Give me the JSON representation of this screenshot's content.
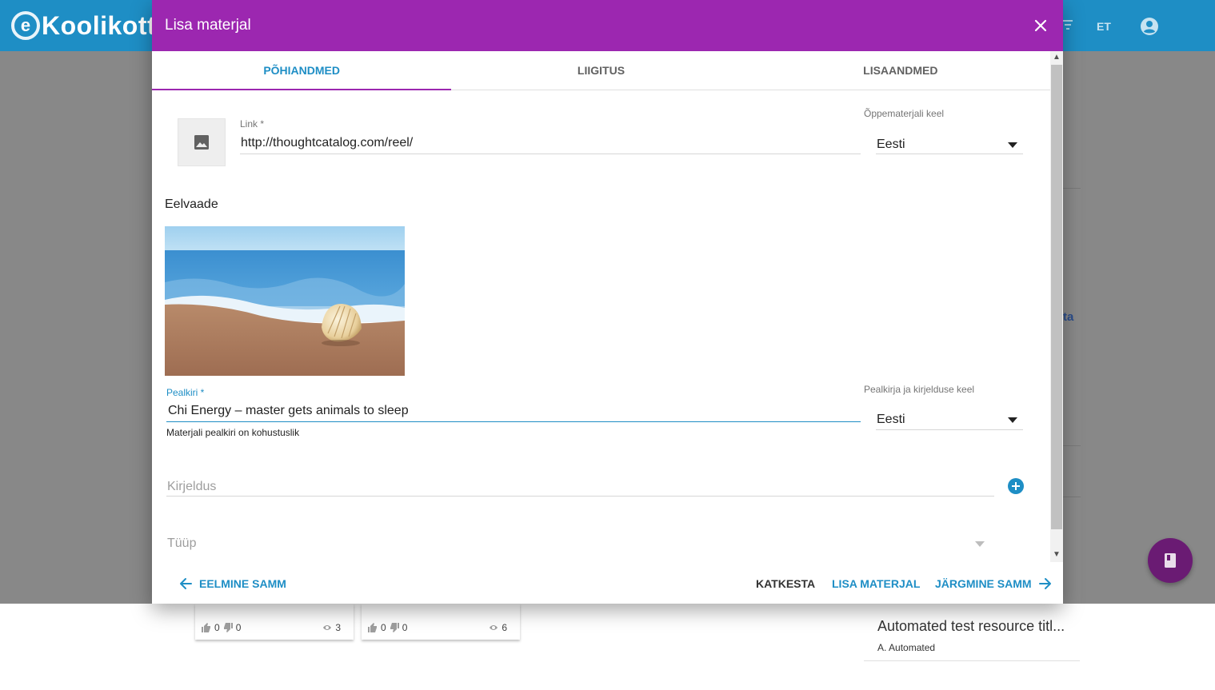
{
  "app": {
    "logo_letter": "e",
    "logo_text": "Koolikott",
    "language": "ET",
    "accent": "#1e8ec5",
    "background_fragment": "ta"
  },
  "dialog": {
    "title": "Lisa materjal",
    "header_color": "#9c27b0",
    "tabs": [
      {
        "label": "PÕHIANDMED",
        "active": true
      },
      {
        "label": "LIIGITUS",
        "active": false
      },
      {
        "label": "LISAANDMED",
        "active": false
      }
    ],
    "link": {
      "label": "Link *",
      "value": "http://thoughtcatalog.com/reel/"
    },
    "material_language": {
      "label": "Õppematerjali keel",
      "value": "Eesti"
    },
    "preview": {
      "title": "Eelvaade",
      "image": "seashell-on-beach"
    },
    "title_field": {
      "label": "Pealkiri *",
      "value": "Chi Energy – master gets animals to sleep",
      "hint": "Materjali pealkiri on kohustuslik"
    },
    "title_language": {
      "label": "Pealkirja ja kirjelduse keel",
      "value": "Eesti"
    },
    "description": {
      "placeholder": "Kirjeldus"
    },
    "type": {
      "placeholder": "Tüüp"
    },
    "footer": {
      "previous": "EELMINE SAMM",
      "cancel": "KATKESTA",
      "add": "LISA MATERJAL",
      "next": "JÄRGMINE SAMM"
    }
  },
  "background": {
    "cards": [
      {
        "likes": "0",
        "dislikes": "0",
        "views": "3"
      },
      {
        "likes": "0",
        "dislikes": "0",
        "views": "6"
      }
    ],
    "list_item": {
      "title": "Automated test resource titl...",
      "author": "A. Automated"
    }
  }
}
